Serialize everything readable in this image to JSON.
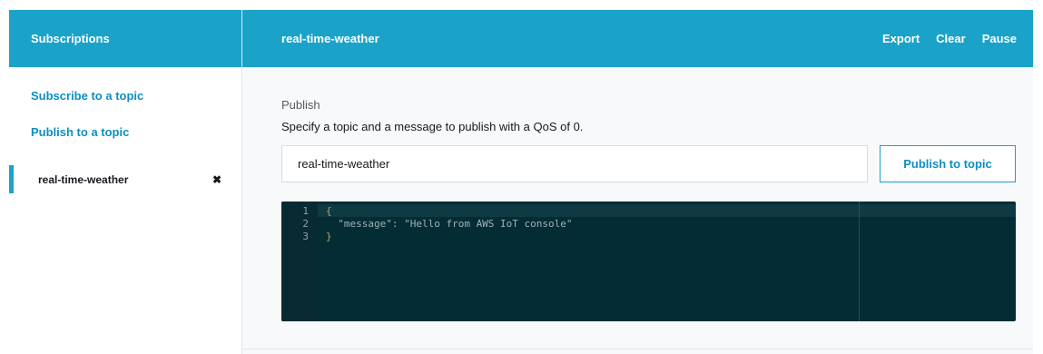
{
  "sidebar": {
    "title": "Subscriptions",
    "links": [
      {
        "label": "Subscribe to a topic"
      },
      {
        "label": "Publish to a topic"
      }
    ],
    "subscriptions": [
      {
        "label": "real-time-weather",
        "close_glyph": "✖"
      }
    ]
  },
  "header": {
    "topic": "real-time-weather",
    "actions": [
      "Export",
      "Clear",
      "Pause"
    ]
  },
  "publish": {
    "heading": "Publish",
    "description": "Specify a topic and a message to publish with a QoS of 0.",
    "topic_value": "real-time-weather",
    "button_label": "Publish to topic"
  },
  "editor": {
    "line_numbers": [
      "1",
      "2",
      "3"
    ],
    "lines": [
      "{",
      "  \"message\": \"Hello from AWS IoT console\"",
      "}"
    ]
  },
  "colors": {
    "header_bg": "#1ba2c9",
    "link": "#0d8ec2",
    "editor_bg": "#042c35"
  }
}
